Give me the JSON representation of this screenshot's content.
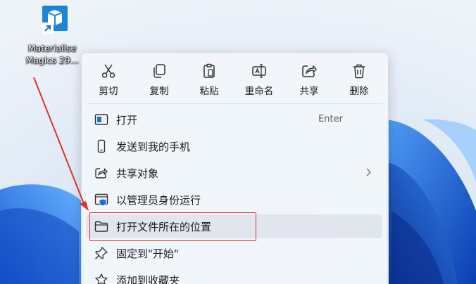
{
  "desktop": {
    "shortcut": {
      "label_line1": "Materialise",
      "label_line2": "Magics 29..."
    }
  },
  "context_menu": {
    "toolbar": [
      {
        "label": "剪切",
        "icon": "cut-icon"
      },
      {
        "label": "复制",
        "icon": "copy-icon"
      },
      {
        "label": "粘贴",
        "icon": "paste-icon"
      },
      {
        "label": "重命名",
        "icon": "rename-icon"
      },
      {
        "label": "共享",
        "icon": "share-icon"
      },
      {
        "label": "删除",
        "icon": "delete-icon"
      }
    ],
    "items": [
      {
        "label": "打开",
        "shortcut": "Enter",
        "icon": "open-app-icon"
      },
      {
        "label": "发送到我的手机",
        "icon": "phone-icon"
      },
      {
        "label": "共享对象",
        "icon": "share-icon",
        "has_submenu": true
      },
      {
        "label": "以管理员身份运行",
        "icon": "shield-icon"
      },
      {
        "label": "打开文件所在的位置",
        "icon": "folder-icon",
        "highlighted": true
      },
      {
        "label": "固定到\"开始\"",
        "icon": "pin-icon"
      },
      {
        "label": "添加到收藏夹",
        "icon": "star-icon"
      }
    ]
  },
  "colors": {
    "annotation": "#e0322c",
    "accent": "#0067c0",
    "wallpaper_blue": "#1565d8"
  }
}
